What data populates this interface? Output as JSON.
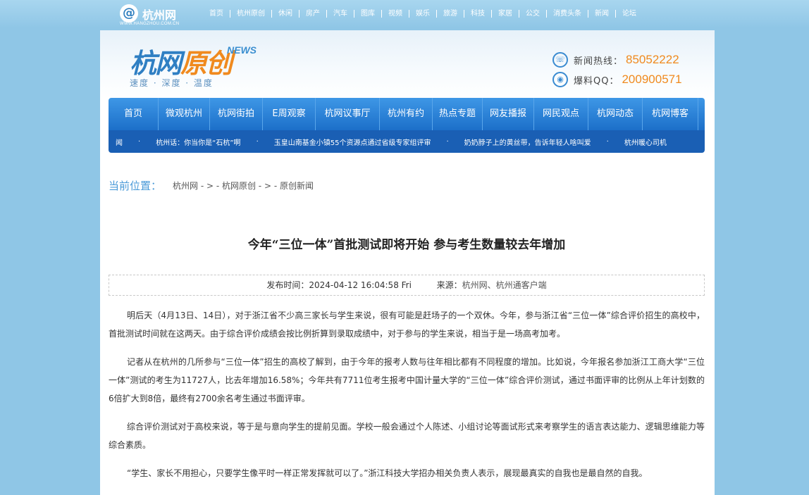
{
  "site": {
    "logo_text": "杭州网",
    "logo_domain": "WWW.HANGZHOU.COM.CN",
    "logo_glyph": "@"
  },
  "topnav": [
    "首页",
    "杭州原创",
    "休闲",
    "房产",
    "汽车",
    "图库",
    "视频",
    "娱乐",
    "旅游",
    "科技",
    "家居",
    "公交",
    "消费头条",
    "新闻",
    "论坛"
  ],
  "banner": {
    "brand": "杭网",
    "brand_accent": "原创",
    "brand_news": "NEWS",
    "slogan": "速度 · 深度 · 温度",
    "hotline_label": "新闻热线：",
    "hotline_value": "85052222",
    "qq_label": "爆料QQ：",
    "qq_value": "200900571",
    "accent_color": "#f08a1e",
    "brand_color": "#2f7fc3"
  },
  "mainnav": [
    "首页",
    "微观杭州",
    "杭网街拍",
    "E周观察",
    "杭网议事厅",
    "杭州有约",
    "热点专题",
    "网友播报",
    "网民观点",
    "杭网动态",
    "杭网博客"
  ],
  "ticker": [
    "闻",
    "杭州话：你当你是“石杭”啊",
    "玉皇山南基金小镇55个资源点通过省级专家组评审",
    "奶奶脖子上的黄丝带，告诉年轻人啥叫爱",
    "杭州暖心司机"
  ],
  "breadcrumb": {
    "label": "当前位置：",
    "path": "杭州网 - > - 杭网原创 - > - 原创新闻"
  },
  "article": {
    "title": "今年“三位一体”首批测试即将开始 参与考生数量较去年增加",
    "meta_time_label": "发布时间：",
    "meta_time": "2024-04-12 16:04:58 Fri",
    "meta_source_label": "来源：",
    "meta_source": "杭州网、杭州通客户端",
    "paragraphs": [
      "明后天（4月13日、14日），对于浙江省不少高三家长与学生来说，很有可能是赶场子的一个双休。今年，参与浙江省“三位一体”综合评价招生的高校中，首批测试时间就在这两天。由于综合评价成绩会按比例折算到录取成绩中，对于参与的学生来说，相当于是一场高考加考。",
      "记者从在杭州的几所参与“三位一体”招生的高校了解到，由于今年的报考人数与往年相比都有不同程度的增加。比如说，今年报名参加浙江工商大学“三位一体”测试的考生为11727人，比去年增加16.58%；今年共有7711位考生报考中国计量大学的“三位一体”综合评价测试，通过书面评审的比例从上年计划数的6倍扩大到8倍，最终有2700余名考生通过书面评审。",
      "综合评价测试对于高校来说，等于是与意向学生的提前见面。学校一般会通过个人陈述、小组讨论等面试形式来考察学生的语言表达能力、逻辑思维能力等综合素质。",
      "“学生、家长不用担心，只要学生像平时一样正常发挥就可以了。”浙江科技大学招办相关负责人表示，展现最真实的自我也是最自然的自我。"
    ]
  }
}
